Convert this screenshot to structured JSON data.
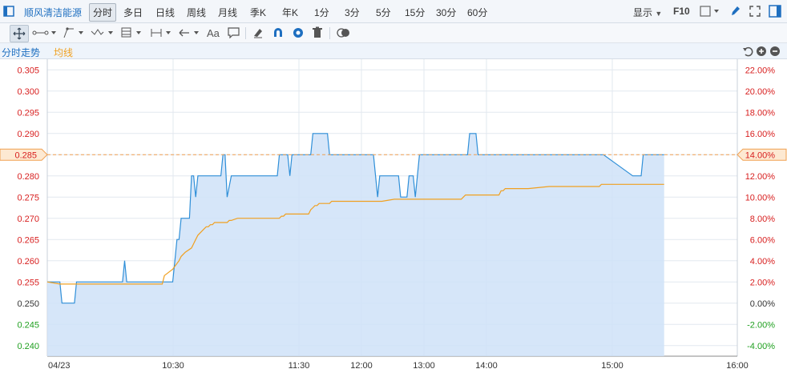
{
  "toolbar": {
    "stock_name": "顺风清洁能源",
    "periods": [
      "分时",
      "多日",
      "日线",
      "周线",
      "月线",
      "季K",
      "年K",
      "1分",
      "3分",
      "5分",
      "15分",
      "30分",
      "60分"
    ],
    "selected_period": "分时",
    "display_label": "显示",
    "f10_label": "F10",
    "text_tool": "Aa"
  },
  "subheader": {
    "tab_main": "分时走势",
    "tab_avg": "均线"
  },
  "chart_data": {
    "type": "line",
    "x_ticks": [
      "04/23",
      "10:30",
      "11:30",
      "12:00",
      "13:00",
      "14:00",
      "15:00",
      "16:00"
    ],
    "y_left_ticks": [
      "0.305",
      "0.300",
      "0.295",
      "0.290",
      "0.285",
      "0.280",
      "0.275",
      "0.270",
      "0.265",
      "0.260",
      "0.255",
      "0.250",
      "0.245",
      "0.240"
    ],
    "y_right_ticks": [
      "22.00%",
      "20.00%",
      "18.00%",
      "16.00%",
      "14.00%",
      "12.00%",
      "10.00%",
      "8.00%",
      "6.00%",
      "4.00%",
      "2.00%",
      "0.00%",
      "-2.00%",
      "-4.00%"
    ],
    "ylim": [
      0.2375,
      0.3075
    ],
    "prev_close": 0.25,
    "reference_price": 0.285,
    "reference_price_label": "0.285",
    "reference_pct_label": "14.00%",
    "xlim": [
      0,
      330
    ],
    "series": [
      {
        "x": [
          0,
          6,
          7,
          13,
          14,
          36,
          37,
          38,
          39,
          60,
          61,
          62,
          63,
          64,
          65,
          66,
          67,
          68,
          69,
          70,
          71,
          72,
          74,
          76,
          77,
          78,
          79,
          80,
          81,
          82,
          83,
          84,
          85,
          86,
          88,
          90,
          91,
          110,
          111,
          112,
          114,
          115,
          116,
          117,
          125,
          126,
          127,
          128,
          129,
          134,
          135,
          136,
          137,
          138,
          156,
          157,
          158,
          159,
          166,
          167,
          168,
          169,
          170,
          171,
          172,
          173,
          175,
          176,
          177,
          178,
          180,
          183,
          184,
          185,
          199,
          200,
          201,
          202,
          203,
          205,
          206,
          210,
          264,
          265,
          266,
          280,
          281,
          282,
          284,
          285,
          286,
          287,
          288,
          295
        ],
        "y": [
          0.255,
          0.255,
          0.25,
          0.25,
          0.255,
          0.255,
          0.26,
          0.255,
          0.255,
          0.255,
          0.26,
          0.265,
          0.265,
          0.27,
          0.27,
          0.27,
          0.27,
          0.27,
          0.28,
          0.28,
          0.275,
          0.28,
          0.28,
          0.28,
          0.28,
          0.28,
          0.28,
          0.28,
          0.28,
          0.28,
          0.28,
          0.285,
          0.285,
          0.275,
          0.28,
          0.28,
          0.28,
          0.28,
          0.285,
          0.285,
          0.285,
          0.285,
          0.28,
          0.285,
          0.285,
          0.285,
          0.29,
          0.29,
          0.29,
          0.29,
          0.285,
          0.285,
          0.285,
          0.285,
          0.285,
          0.28,
          0.275,
          0.28,
          0.28,
          0.28,
          0.28,
          0.275,
          0.275,
          0.275,
          0.275,
          0.28,
          0.28,
          0.275,
          0.28,
          0.285,
          0.285,
          0.285,
          0.285,
          0.285,
          0.285,
          0.285,
          0.285,
          0.29,
          0.29,
          0.29,
          0.285,
          0.285,
          0.285,
          0.285,
          0.285,
          0.28,
          0.28,
          0.28,
          0.28,
          0.285,
          0.285,
          0.285,
          0.285,
          0.285
        ]
      },
      {
        "x": [
          0,
          6,
          37,
          38,
          55,
          56,
          60,
          63,
          64,
          66,
          69,
          70,
          71,
          72,
          74,
          76,
          77,
          78,
          79,
          80,
          81,
          85,
          86,
          87,
          88,
          91,
          110,
          111,
          112,
          113,
          114,
          115,
          117,
          125,
          126,
          127,
          128,
          129,
          130,
          135,
          136,
          137,
          138,
          150,
          160,
          166,
          176,
          180,
          183,
          184,
          185,
          198,
          199,
          200,
          206,
          210,
          216,
          217,
          218,
          219,
          220,
          230,
          240,
          264,
          265,
          266,
          280,
          295
        ],
        "y": [
          0.255,
          0.2545,
          0.2545,
          0.2545,
          0.2545,
          0.2565,
          0.258,
          0.26,
          0.261,
          0.262,
          0.263,
          0.264,
          0.265,
          0.266,
          0.267,
          0.268,
          0.268,
          0.2685,
          0.2685,
          0.269,
          0.269,
          0.269,
          0.269,
          0.2695,
          0.2695,
          0.27,
          0.27,
          0.27,
          0.2705,
          0.2705,
          0.271,
          0.271,
          0.271,
          0.271,
          0.272,
          0.2725,
          0.273,
          0.273,
          0.2735,
          0.2735,
          0.274,
          0.274,
          0.274,
          0.274,
          0.274,
          0.2745,
          0.2745,
          0.2745,
          0.2745,
          0.2745,
          0.2745,
          0.2745,
          0.275,
          0.2755,
          0.2755,
          0.2755,
          0.2755,
          0.2765,
          0.2765,
          0.277,
          0.277,
          0.277,
          0.2775,
          0.2775,
          0.278,
          0.278,
          0.278,
          0.278
        ]
      }
    ],
    "colors": {
      "price_line": "#2f8fd8",
      "price_fill": "#cfe2f8",
      "avg_line": "#f0a020",
      "grid": "#e2e8ef",
      "up_text": "#d82020",
      "down_text": "#20a020",
      "neutral_text": "#333333",
      "ref_line": "#f0a050"
    }
  }
}
